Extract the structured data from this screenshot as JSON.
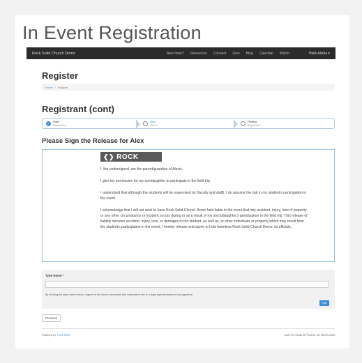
{
  "screenshot_title": "In Event Registration",
  "navbar": {
    "brand": "Rock Solid Church Demo",
    "links": [
      "New Here?",
      "Resources",
      "Connect",
      "Give",
      "Blog",
      "Calendar",
      "Watch"
    ],
    "user": "Hello Alisha ▾"
  },
  "page": {
    "title": "Register",
    "breadcrumb": {
      "home": "Home",
      "separator": "/",
      "current": "Register"
    },
    "section_title": "Registrant (cont)"
  },
  "steps": [
    {
      "title": "Start",
      "subtitle": "Registration",
      "state": "done"
    },
    {
      "title": "Alex",
      "subtitle": "Waiver",
      "state": "current"
    },
    {
      "title": "Finalize",
      "subtitle": "Registration",
      "state": "pending"
    }
  ],
  "release": {
    "heading": "Please Sign the Release for Alex",
    "logo_text": "ROCK",
    "paragraphs": [
      "I, the undersigned, am the parent/guardian of Alexis.",
      "I give my permission for my son/daughter to participate in the field trip.",
      "I understand that although the students will be supervised by (faculty and staff), I do assume the risk in my student's participation in the event.",
      "I acknowledge that I will not seek to have Rock Solid Church Demo held liable in the event that any accident, injury, loss of property or any other circumstance or incident occurs during or as a result of my son's/daughter's participation in the field trip. This release of liability includes accident, injury, loss, or damages to the student, as well as, to other individuals or property which may result from the student's participation in the event. I hereby release and agree to hold harmless Rock Solid Church Demo, its officials,"
    ]
  },
  "signature": {
    "label": "Type Name",
    "required_mark": "*",
    "value": "",
    "note": "By clicking the sign button below, I agree to the above document and understand this is a legal representation of my signature.",
    "button": "Sign"
  },
  "previous_button": "Previous",
  "footer": {
    "powered_by": "Powered by:",
    "powered_link": "Rock RMS",
    "address": "3120 W Cholla St Phoenix, AZ 85029-4113"
  }
}
